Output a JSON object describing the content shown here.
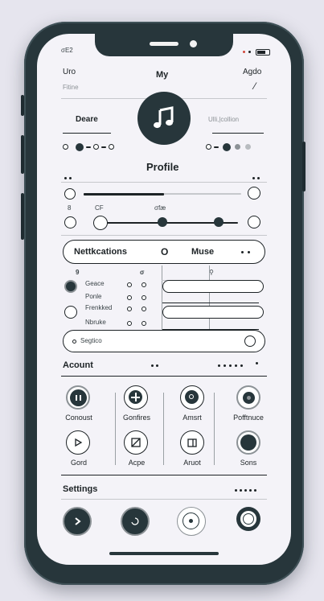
{
  "status": {
    "time": "σE2"
  },
  "header": {
    "left_top": "Uro",
    "left_sub": "Fitine",
    "center_title": "My",
    "right_top": "Agdo",
    "right_icon": "⁄"
  },
  "profile": {
    "left_label": "Deare",
    "right_label": "Ulli,|collion",
    "title": "Profile"
  },
  "player": {
    "sublabel_left": "CF",
    "sublabel_mid": "σfæ"
  },
  "tabs": {
    "left": "Nettkcations",
    "mid": "O",
    "right": "Muse"
  },
  "list": {
    "col1": "9",
    "col2": "σ",
    "items": [
      "Geace",
      "Ponle",
      "Frenkked",
      "Nbruke"
    ]
  },
  "search": {
    "label": "Segtico"
  },
  "account": {
    "heading": "Acount",
    "tiles": [
      "Conoust",
      "Gonfires",
      "Amsrt",
      "Pofftnuce",
      "Gord",
      "Acpe",
      "Aruot",
      "Sons"
    ]
  },
  "settings": {
    "heading": "Settings"
  },
  "colors": {
    "frame": "#27363b",
    "screen": "#f4f3f8",
    "ink": "#1d2326"
  },
  "icons": [
    "music-note-icon",
    "play-icon",
    "record-icon",
    "battery-icon",
    "crop-icon",
    "window-icon"
  ]
}
